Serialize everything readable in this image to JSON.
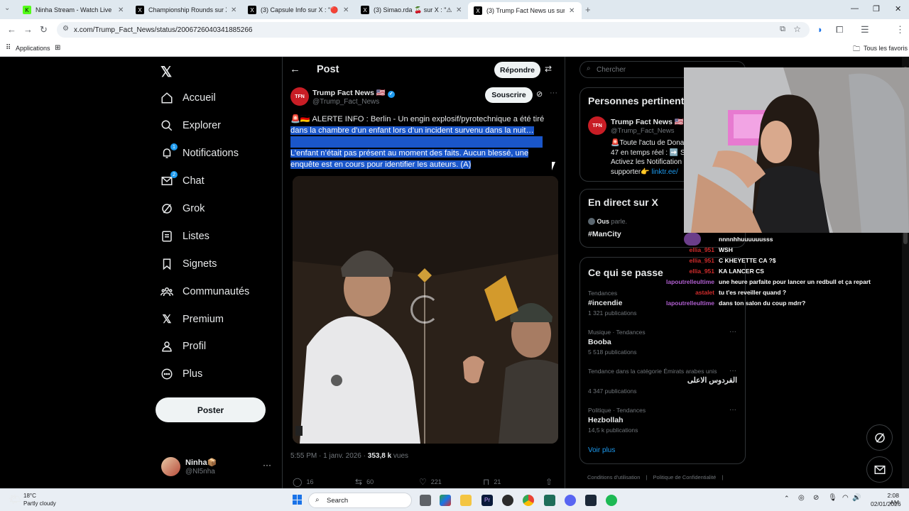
{
  "browser": {
    "tabs": [
      {
        "title": "Ninha Stream - Watch Live on K",
        "favicon": "K",
        "favicon_color": "#53fc18"
      },
      {
        "title": "Championship Rounds sur X : \"",
        "favicon": "X",
        "favicon_color": "#000000"
      },
      {
        "title": "(3) Capsule Info sur X : \"🔴 ⚠ A",
        "favicon": "X",
        "favicon_color": "#000000"
      },
      {
        "title": "(3) Simao.rda 🍒 sur X : \"⚠Le 3",
        "favicon": "X",
        "favicon_color": "#000000"
      },
      {
        "title": "(3) Trump Fact News us sur X : \"",
        "favicon": "X",
        "favicon_color": "#000000"
      }
    ],
    "url": "x.com/Trump_Fact_News/status/2006726040341885266",
    "bookmarks": {
      "apps": "Applications",
      "all": "Tous les favoris"
    }
  },
  "sidebar": {
    "items": [
      {
        "label": "Accueil",
        "icon": "home-icon"
      },
      {
        "label": "Explorer",
        "icon": "search-icon"
      },
      {
        "label": "Notifications",
        "icon": "bell-icon",
        "badge": "1"
      },
      {
        "label": "Chat",
        "icon": "mail-icon",
        "badge": "2"
      },
      {
        "label": "Grok",
        "icon": "grok-icon"
      },
      {
        "label": "Listes",
        "icon": "list-icon"
      },
      {
        "label": "Signets",
        "icon": "bookmark-icon"
      },
      {
        "label": "Communautés",
        "icon": "communities-icon"
      },
      {
        "label": "Premium",
        "icon": "x-logo-icon"
      },
      {
        "label": "Profil",
        "icon": "person-icon"
      },
      {
        "label": "Plus",
        "icon": "more-circle-icon"
      }
    ],
    "post_button": "Poster",
    "account": {
      "name": "Ninha📦",
      "handle": "@Nl5nha"
    }
  },
  "post": {
    "header": "Post",
    "reply_button": "Répondre",
    "author_name": "Trump Fact News 🇺🇸",
    "author_handle": "@Trump_Fact_News",
    "subscribe_button": "Souscrire",
    "text_first": "🚨🇩🇪 ALERTE INFO : Berlin - Un engin explosif/pyrotechnique a été tiré",
    "text_selected_1": "dans la chambre d’un enfant lors d’un incident survenu dans la nuit…",
    "text_selected_2": "L’enfant n’était pas présent au moment des faits. Aucun blessé, une enquête est en cours pour identifier les auteurs. (A)",
    "time": "5:55 PM · 1 janv. 2026 · ",
    "views_count": "353,8 k",
    "views_label": " vues",
    "replies": "16",
    "reposts": "60",
    "likes": "221",
    "bookmarks": "21"
  },
  "right": {
    "search_placeholder": "Chercher",
    "people_title": "Personnes pertinentes",
    "person_name": "Trump Fact News 🇺🇸",
    "person_handle": "@Trump_Fact_News",
    "person_bio_1": "🚨Toute l'actu de Dona",
    "person_bio_2": "47 en temps réel : ➡️ S",
    "person_bio_3": "Activez les Notification",
    "person_bio_4": "supporter👉 ",
    "person_link": "linktr.ee/",
    "live_title": "En direct sur X",
    "live_speaker": "Ous",
    "live_speaker_suffix": " parle.",
    "live_tag": "#ManCity",
    "happening_title": "Ce qui se passe",
    "trends": [
      {
        "meta": "Tendances",
        "name": "#incendie",
        "count": "1 321 publications"
      },
      {
        "meta": "Musique · Tendances",
        "name": "Booba",
        "count": "5 518 publications"
      },
      {
        "meta": "Tendance dans la catégorie Émirats arabes unis",
        "name": "الفردوس الاعلى",
        "count": "4 347 publications"
      },
      {
        "meta": "Politique · Tendances",
        "name": "Hezbollah",
        "count": "14,5 k publications"
      }
    ],
    "see_more": "Voir plus",
    "footer_1": "Conditions d'utilisation",
    "footer_2": "Politique de Confidentialité"
  },
  "chat": [
    {
      "user": "",
      "msg": "nnnnhhuuuuuusss",
      "color": "#b05fd0"
    },
    {
      "user": "ellia_951",
      "msg": "WSH",
      "color": "#d12c2c"
    },
    {
      "user": "ellia_951",
      "msg": "C KHEYETTE CA ?$",
      "color": "#d12c2c"
    },
    {
      "user": "ellia_951",
      "msg": "KA LANCER CS",
      "color": "#d12c2c"
    },
    {
      "user": "lapoutrelleultime",
      "msg": "une heure parfaite pour lancer un redbull et ça repart",
      "color": "#b05fd0"
    },
    {
      "user": "astalet",
      "msg": "tu t'es reveiller quand ?",
      "color": "#d12c2c"
    },
    {
      "user": "lapoutrelleultime",
      "msg": "dans ton salon du coup mdrr?",
      "color": "#b05fd0"
    }
  ],
  "taskbar": {
    "temp": "18°C",
    "weather": "Partly cloudy",
    "search": "Search",
    "time": "2:08 AM",
    "date": "02/01/2026"
  }
}
